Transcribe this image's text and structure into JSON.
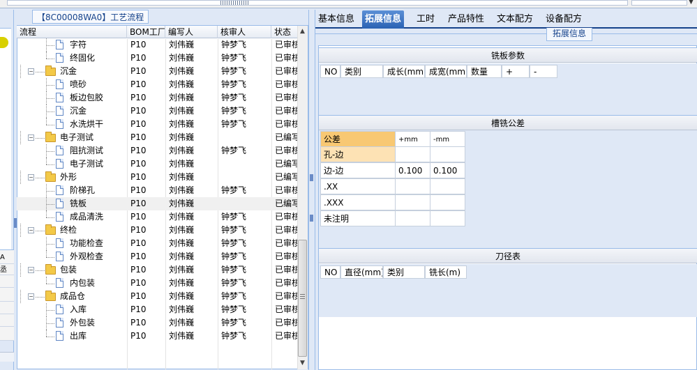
{
  "panel": {
    "title": "【8C00008WA0】工艺流程"
  },
  "left_edge": {
    "label_a": "A",
    "label_b": "丞"
  },
  "grid": {
    "columns": {
      "flow": "流程",
      "bom": "BOM工厂",
      "author": "编写人",
      "reviewer": "核审人",
      "status": "状态"
    },
    "rows": [
      {
        "label": "字符",
        "type": "doc",
        "level": 2,
        "bom": "P10",
        "author": "刘伟巍",
        "reviewer": "钟梦飞",
        "status": "已审核"
      },
      {
        "label": "终固化",
        "type": "doc",
        "level": 2,
        "bom": "P10",
        "author": "刘伟巍",
        "reviewer": "钟梦飞",
        "status": "已审核"
      },
      {
        "label": "沉金",
        "type": "folder",
        "level": 1,
        "bom": "P10",
        "author": "刘伟巍",
        "reviewer": "钟梦飞",
        "status": "已审核"
      },
      {
        "label": "喷砂",
        "type": "doc",
        "level": 2,
        "bom": "P10",
        "author": "刘伟巍",
        "reviewer": "钟梦飞",
        "status": "已审核"
      },
      {
        "label": "板边包胶",
        "type": "doc",
        "level": 2,
        "bom": "P10",
        "author": "刘伟巍",
        "reviewer": "钟梦飞",
        "status": "已审核"
      },
      {
        "label": "沉金",
        "type": "doc",
        "level": 2,
        "bom": "P10",
        "author": "刘伟巍",
        "reviewer": "钟梦飞",
        "status": "已审核"
      },
      {
        "label": "水洗烘干",
        "type": "doc",
        "level": 2,
        "bom": "P10",
        "author": "刘伟巍",
        "reviewer": "钟梦飞",
        "status": "已审核"
      },
      {
        "label": "电子测试",
        "type": "folder",
        "level": 1,
        "bom": "P10",
        "author": "刘伟巍",
        "reviewer": "",
        "status": "已编写"
      },
      {
        "label": "阻抗测试",
        "type": "doc",
        "level": 2,
        "bom": "P10",
        "author": "刘伟巍",
        "reviewer": "钟梦飞",
        "status": "已审核"
      },
      {
        "label": "电子测试",
        "type": "doc",
        "level": 2,
        "bom": "P10",
        "author": "刘伟巍",
        "reviewer": "",
        "status": "已编写"
      },
      {
        "label": "外形",
        "type": "folder",
        "level": 1,
        "bom": "P10",
        "author": "刘伟巍",
        "reviewer": "",
        "status": "已编写"
      },
      {
        "label": "阶梯孔",
        "type": "doc",
        "level": 2,
        "bom": "P10",
        "author": "刘伟巍",
        "reviewer": "钟梦飞",
        "status": "已审核"
      },
      {
        "label": "铣板",
        "type": "doc",
        "level": 2,
        "bom": "P10",
        "author": "刘伟巍",
        "reviewer": "",
        "status": "已编写",
        "selected": true
      },
      {
        "label": "成品清洗",
        "type": "doc",
        "level": 2,
        "bom": "P10",
        "author": "刘伟巍",
        "reviewer": "钟梦飞",
        "status": "已审核"
      },
      {
        "label": "终检",
        "type": "folder",
        "level": 1,
        "bom": "P10",
        "author": "刘伟巍",
        "reviewer": "钟梦飞",
        "status": "已审核"
      },
      {
        "label": "功能检查",
        "type": "doc",
        "level": 2,
        "bom": "P10",
        "author": "刘伟巍",
        "reviewer": "钟梦飞",
        "status": "已审核"
      },
      {
        "label": "外观检查",
        "type": "doc",
        "level": 2,
        "bom": "P10",
        "author": "刘伟巍",
        "reviewer": "钟梦飞",
        "status": "已审核"
      },
      {
        "label": "包装",
        "type": "folder",
        "level": 1,
        "bom": "P10",
        "author": "刘伟巍",
        "reviewer": "钟梦飞",
        "status": "已审核"
      },
      {
        "label": "内包装",
        "type": "doc",
        "level": 2,
        "bom": "P10",
        "author": "刘伟巍",
        "reviewer": "钟梦飞",
        "status": "已审核"
      },
      {
        "label": "成品仓",
        "type": "folder",
        "level": 1,
        "bom": "P10",
        "author": "刘伟巍",
        "reviewer": "钟梦飞",
        "status": "已审核"
      },
      {
        "label": "入库",
        "type": "doc",
        "level": 2,
        "bom": "P10",
        "author": "刘伟巍",
        "reviewer": "钟梦飞",
        "status": "已审核"
      },
      {
        "label": "外包装",
        "type": "doc",
        "level": 2,
        "bom": "P10",
        "author": "刘伟巍",
        "reviewer": "钟梦飞",
        "status": "已审核"
      },
      {
        "label": "出库",
        "type": "doc",
        "level": 2,
        "bom": "P10",
        "author": "刘伟巍",
        "reviewer": "钟梦飞",
        "status": "已审核"
      }
    ]
  },
  "tabs": [
    {
      "label": "基本信息",
      "active": false
    },
    {
      "label": "拓展信息",
      "active": true
    },
    {
      "label": "工时",
      "active": false
    },
    {
      "label": "产品特性",
      "active": false
    },
    {
      "label": "文本配方",
      "active": false
    },
    {
      "label": "设备配方",
      "active": false
    }
  ],
  "sub_tab": "拓展信息",
  "milling_params": {
    "title": "铣板参数",
    "columns": [
      "NO",
      "类别",
      "成长(mm)",
      "成宽(mm)",
      "数量",
      "+",
      "-"
    ]
  },
  "slot_tolerance": {
    "title": "槽铣公差",
    "header": [
      "公差",
      "+mm",
      "-mm"
    ],
    "rows": [
      {
        "label": "孔-边",
        "plus": "",
        "minus": ""
      },
      {
        "label": "边-边",
        "plus": "0.100",
        "minus": "0.100"
      },
      {
        "label": ".XX",
        "plus": "",
        "minus": ""
      },
      {
        "label": ".XXX",
        "plus": "",
        "minus": ""
      },
      {
        "label": "未注明",
        "plus": "",
        "minus": ""
      }
    ]
  },
  "tool_diameter": {
    "title": "刀径表",
    "columns": [
      "NO",
      "直径(mm)",
      "类别",
      "铣长(m)"
    ]
  },
  "colors": {
    "accent": "#15428b",
    "tab_active": "#3a72c4",
    "highlight": "#f8c873",
    "panel_bg": "#dfe8f6"
  }
}
